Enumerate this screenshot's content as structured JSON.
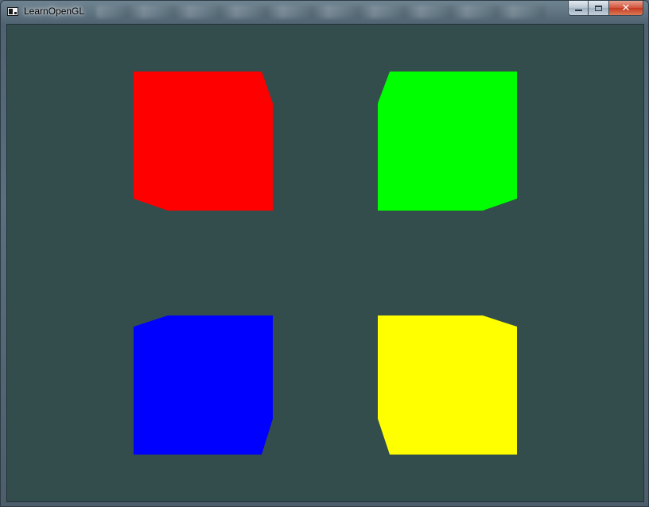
{
  "window": {
    "title": "LearnOpenGL",
    "icon": "app-window-icon",
    "caption_buttons": {
      "minimize_icon": "minimize-icon",
      "maximize_icon": "maximize-icon",
      "close_label": "✕"
    }
  },
  "scene": {
    "clear_color": "#334d4d",
    "cubes": [
      {
        "name": "red-cube",
        "color": "#ff0000"
      },
      {
        "name": "green-cube",
        "color": "#00ff00"
      },
      {
        "name": "blue-cube",
        "color": "#0000ff"
      },
      {
        "name": "yellow-cube",
        "color": "#ffff00"
      }
    ]
  }
}
